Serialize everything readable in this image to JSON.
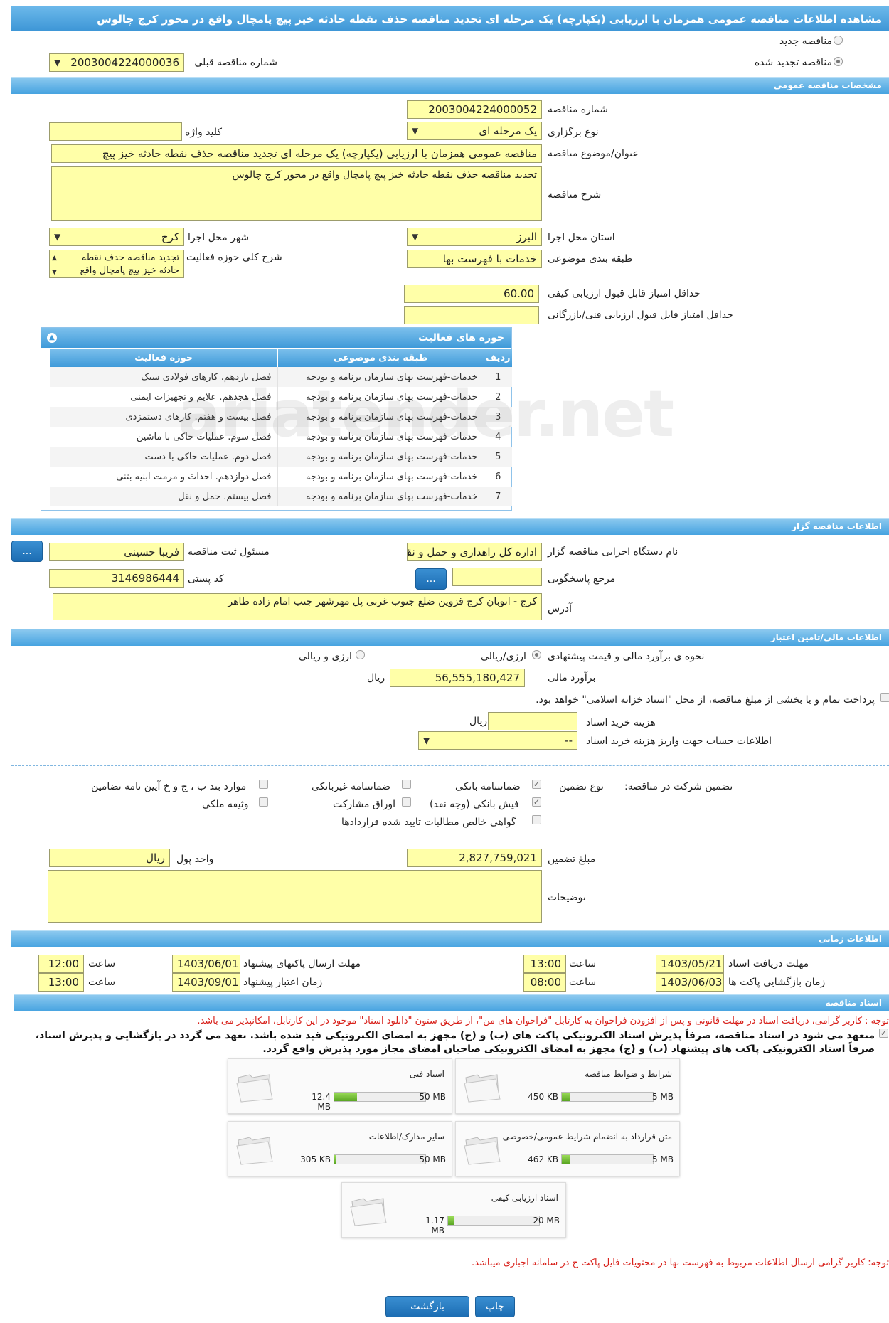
{
  "header": {
    "title": "مشاهده اطلاعات مناقصه عمومی همزمان با ارزیابی (یکپارچه) یک مرحله ای تجدید مناقصه حذف نقطه حادثه خیز پیچ پامچال واقع در محور کرج چالوس"
  },
  "top": {
    "new_label": "مناقصه جدید",
    "renewed_label": "مناقصه تجدید شده",
    "prev_no_label": "شماره مناقصه قبلی",
    "prev_no": "2003004224000036"
  },
  "general": {
    "title": "مشخصات مناقصه عمومی",
    "no_label": "شماره مناقصه",
    "no": "2003004224000052",
    "type_label": "نوع برگزاری",
    "type": "یک مرحله ای",
    "keyword_label": "کلید واژه",
    "keyword": "",
    "subject_label": "عنوان/موضوع مناقصه",
    "subject": "مناقصه عمومی همزمان با ارزیابی (یکپارچه) یک مرحله ای تجدید مناقصه  حذف نقطه حادثه خیز  پیچ",
    "desc_label": "شرح مناقصه",
    "desc": "تجدید مناقصه  حذف نقطه حادثه خیز  پیچ پامچال واقع در محور کرج چالوس",
    "province_label": "استان محل اجرا",
    "province": "البرز",
    "city_label": "شهر محل اجرا",
    "city": "کرج",
    "category_label": "طبقه بندی موضوعی",
    "category": "خدمات با فهرست بها",
    "activity_desc_label": "شرح کلی حوزه فعالیت",
    "activity_desc": "تجدید مناقصه  حذف نقطه حادثه خیز  پیچ پامچال واقع",
    "min_quality_label": "حداقل امتیاز قابل قبول ارزیابی کیفی",
    "min_quality": "60.00",
    "min_tech_label": "حداقل امتیاز قابل قبول ارزیابی فنی/بازرگانی",
    "min_tech": ""
  },
  "activities": {
    "title": "حوزه های فعالیت",
    "headers": [
      "ردیف",
      "طبقه بندی موضوعی",
      "حوزه فعالیت"
    ],
    "rows": [
      [
        "1",
        "خدمات-فهرست بهای سازمان برنامه و بودجه",
        "فصل یازدهم. کارهای فولادی سبک"
      ],
      [
        "2",
        "خدمات-فهرست بهای سازمان برنامه و بودجه",
        "فصل هجدهم. علایم و تجهیزات ایمنی"
      ],
      [
        "3",
        "خدمات-فهرست بهای سازمان برنامه و بودجه",
        "فصل بیست و هفتم. کارهای دستمزدی"
      ],
      [
        "4",
        "خدمات-فهرست بهای سازمان برنامه و بودجه",
        "فصل سوم. عملیات خاکی با ماشین"
      ],
      [
        "5",
        "خدمات-فهرست بهای سازمان برنامه و بودجه",
        "فصل دوم. عملیات خاکی با دست"
      ],
      [
        "6",
        "خدمات-فهرست بهای سازمان برنامه و بودجه",
        "فصل دوازدهم. احداث و مرمت ابنیه بتنی"
      ],
      [
        "7",
        "خدمات-فهرست بهای سازمان برنامه و بودجه",
        "فصل بیستم. حمل و نقل"
      ]
    ]
  },
  "organizer": {
    "title": "اطلاعات مناقصه گزار",
    "org_label": "نام دستگاه اجرایی مناقصه گزار",
    "org": "اداره کل راهداری و حمل و نقل",
    "resp_label": "مسئول ثبت مناقصه",
    "resp": "فریبا حسینی",
    "ref_label": "مرجع پاسخگویی",
    "ref": "",
    "postal_label": "کد پستی",
    "postal": "3146986444",
    "addr_label": "آدرس",
    "addr": "کرج - اتوبان کرج قزوین ضلع جنوب غربی پل مهرشهر جنب امام زاده طاهر",
    "btn": "..."
  },
  "finance": {
    "title": "اطلاعات مالی/تامین اعتبار",
    "method_label": "نحوه ی برآورد مالی و قیمت پیشنهادی",
    "opt1": "ارزی/ریالی",
    "opt2": "ارزی و ریالی",
    "estimate_label": "برآورد مالی",
    "estimate": "56,555,180,427",
    "unit": "ریال",
    "treasury": "پرداخت تمام و یا بخشی از مبلغ مناقصه، از محل \"اسناد خزانه اسلامی\" خواهد بود.",
    "doc_cost_label": "هزینه خرید اسناد",
    "doc_cost": "",
    "doc_cost_unit": "ریال",
    "account_label": "اطلاعات حساب جهت واریز هزینه خرید اسناد",
    "account": "--"
  },
  "guarantee": {
    "label": "تضمین شرکت در مناقصه:",
    "type_label": "نوع تضمین",
    "bank": "ضمانتنامه بانکی",
    "nonbank": "ضمانتنامه غیربانکی",
    "clauses": "موارد بند ب ، ج و خ آیین نامه تضامین",
    "cash": "فیش بانکی (وجه نقد)",
    "bonds": "اوراق مشارکت",
    "property": "وثیقه ملکی",
    "claims": "گواهی خالص مطالبات تایید شده قراردادها",
    "amount_label": "مبلغ تضمین",
    "amount": "2,827,759,021",
    "currency_label": "واحد پول",
    "currency": "ریال",
    "notes_label": "توضیحات",
    "notes": ""
  },
  "timing": {
    "title": "اطلاعات زمانی",
    "receive_label": "مهلت دریافت اسناد",
    "receive_date": "1403/05/21",
    "receive_time": "13:00",
    "send_label": "مهلت ارسال پاکتهای پیشنهاد",
    "send_date": "1403/06/01",
    "send_time": "12:00",
    "open_label": "زمان بازگشایی پاکت ها",
    "open_date": "1403/06/03",
    "open_time": "08:00",
    "valid_label": "زمان اعتبار پیشنهاد",
    "valid_date": "1403/09/01",
    "valid_time": "13:00",
    "time_label": "ساعت"
  },
  "documents": {
    "title": "اسناد مناقصه",
    "note": "توجه : کاربر گرامی، دریافت اسناد در مهلت قانونی و پس از افزودن فراخوان به کارتابل \"فراخوان های من\"، از طریق ستون \"دانلود اسناد\" موجود در این کارتابل، امکانپذیر می باشد.",
    "commit1": "متعهد می شود در اسناد مناقصه، صرفاً پذیرش اسناد الکترونیکی پاکت های (ب) و (ج) مجهز به امضای الکترونیکی قید شده باشد. تعهد می گردد در بازگشایی و پذیرش اسناد،",
    "commit2": "صرفاً اسناد الکترونیکی پاکت های پیشنهاد (ب) و (ج) مجهز به امضای الکترونیکی صاحبان امضای مجاز مورد پذیرش واقع گردد.",
    "files": [
      {
        "name": "شرایط و ضوابط مناقصه",
        "used": "450 KB",
        "max": "5 MB",
        "pct": 9
      },
      {
        "name": "اسناد فنی",
        "used": "12.4 MB",
        "max": "50 MB",
        "pct": 25
      },
      {
        "name": "متن قرارداد به انضمام شرایط عمومی/خصوصی",
        "used": "462 KB",
        "max": "5 MB",
        "pct": 9
      },
      {
        "name": "سایر مدارک/اطلاعات",
        "used": "305 KB",
        "max": "50 MB",
        "pct": 2
      },
      {
        "name": "اسناد ارزیابی کیفی",
        "used": "1.17 MB",
        "max": "20 MB",
        "pct": 6
      }
    ],
    "note2": "توجه: کاربر گرامی ارسال اطلاعات مربوط به فهرست بها در محتویات فایل پاکت ج در سامانه اجباری میباشد."
  },
  "actions": {
    "back": "بازگشت",
    "print": "چاپ"
  },
  "watermark": "ariatender.net"
}
